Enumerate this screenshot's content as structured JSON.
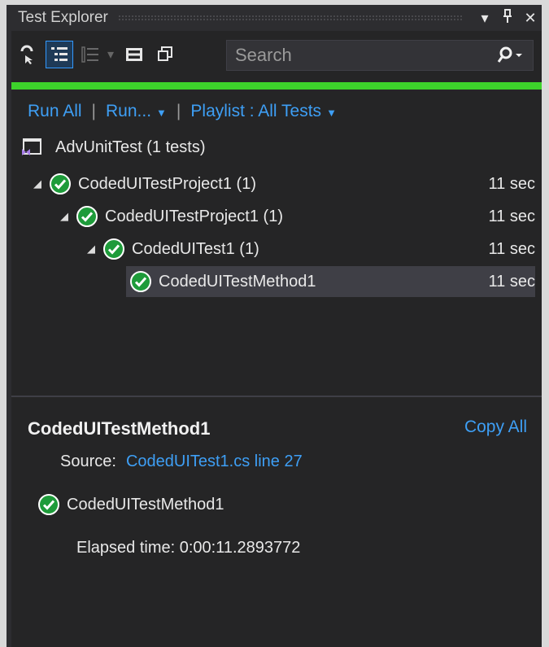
{
  "window": {
    "title": "Test Explorer",
    "buttons": {
      "dropdown": "▾",
      "pin": "⊥",
      "close": "✕"
    }
  },
  "toolbar": {
    "search_placeholder": "Search"
  },
  "progress": {
    "status": "passed",
    "fraction": 1.0,
    "color": "#3dd32b"
  },
  "commands": {
    "run_all": "Run All",
    "run": "Run...",
    "playlist": "Playlist : All Tests"
  },
  "project": {
    "label": "AdvUnitTest (1 tests)"
  },
  "tree": [
    {
      "label": "CodedUITestProject1 (1)",
      "time": "11 sec",
      "level": 0,
      "expandable": true,
      "selected": false
    },
    {
      "label": "CodedUITestProject1 (1)",
      "time": "11 sec",
      "level": 1,
      "expandable": true,
      "selected": false
    },
    {
      "label": "CodedUITest1 (1)",
      "time": "11 sec",
      "level": 2,
      "expandable": true,
      "selected": false
    },
    {
      "label": "CodedUITestMethod1",
      "time": "11 sec",
      "level": 3,
      "expandable": false,
      "selected": true
    }
  ],
  "details": {
    "title": "CodedUITestMethod1",
    "copy_all": "Copy All",
    "source_label": "Source:",
    "source_link": "CodedUITest1.cs line 27",
    "result_label": "CodedUITestMethod1",
    "elapsed": "Elapsed time: 0:00:11.2893772"
  },
  "colors": {
    "pass_green": "#1e9b3a",
    "link_blue": "#3e9ff5",
    "panel_bg": "#252526"
  }
}
